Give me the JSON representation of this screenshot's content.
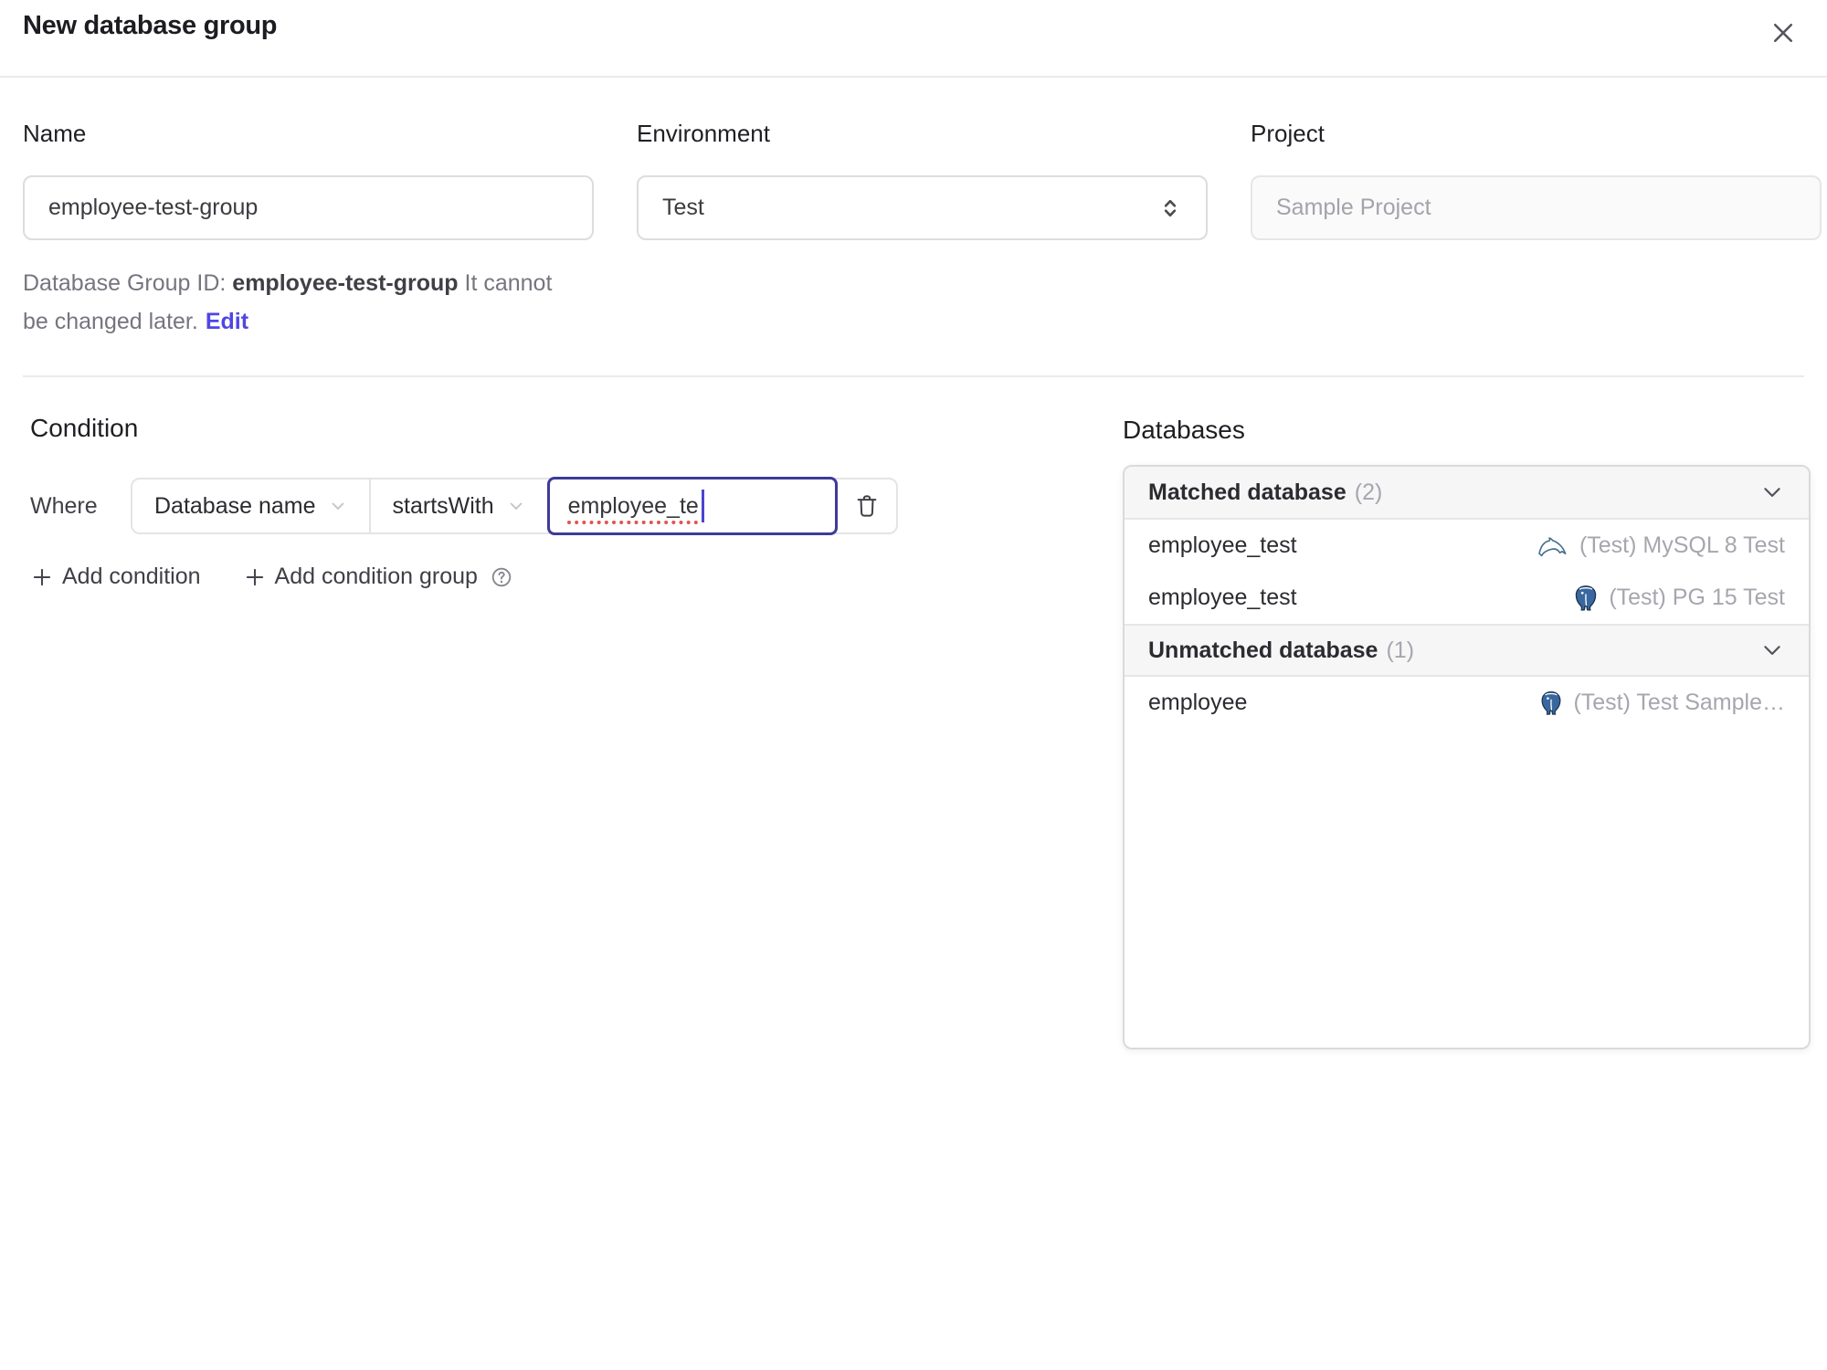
{
  "dialog": {
    "title": "New database group"
  },
  "form": {
    "name": {
      "label": "Name",
      "value": "employee-test-group"
    },
    "environment": {
      "label": "Environment",
      "value": "Test"
    },
    "project": {
      "label": "Project",
      "value": "Sample Project"
    },
    "group_id_note": {
      "prefix": "Database Group ID: ",
      "id": "employee-test-group",
      "suffix": " It cannot be changed later.",
      "edit": "Edit"
    }
  },
  "condition": {
    "heading": "Condition",
    "where_label": "Where",
    "field": "Database name",
    "operator": "startsWith",
    "value": "employee_te",
    "add_condition": "Add condition",
    "add_condition_group": "Add condition group"
  },
  "databases": {
    "heading": "Databases",
    "sections": [
      {
        "title": "Matched database",
        "count": "(2)",
        "rows": [
          {
            "name": "employee_test",
            "engine": "mysql",
            "instance": "(Test) MySQL 8 Test"
          },
          {
            "name": "employee_test",
            "engine": "postgresql",
            "instance": "(Test) PG 15 Test"
          }
        ]
      },
      {
        "title": "Unmatched database",
        "count": "(1)",
        "rows": [
          {
            "name": "employee",
            "engine": "postgresql",
            "instance": "(Test) Test Sample…"
          }
        ]
      }
    ]
  },
  "icons": {
    "close": "x-icon",
    "environment_select": "up-down-chevron-icon",
    "dropdown": "chevron-down-icon",
    "delete": "trash-icon",
    "add": "plus-icon",
    "help": "question-circle-icon",
    "collapse": "chevron-down-icon",
    "mysql": "mysql-dolphin-icon",
    "postgresql": "postgresql-elephant-icon"
  },
  "colors": {
    "accent_link": "#4f46e5",
    "focus_border": "#3e3b99",
    "caret": "#4d43cf",
    "spellcheck_underline": "#e0564e",
    "divider": "#ebebed",
    "panel_header_bg": "#f6f6f7",
    "muted_text": "#a6a6ae",
    "mysql_icon": "#44708f",
    "postgresql_icon": "#39679e"
  }
}
